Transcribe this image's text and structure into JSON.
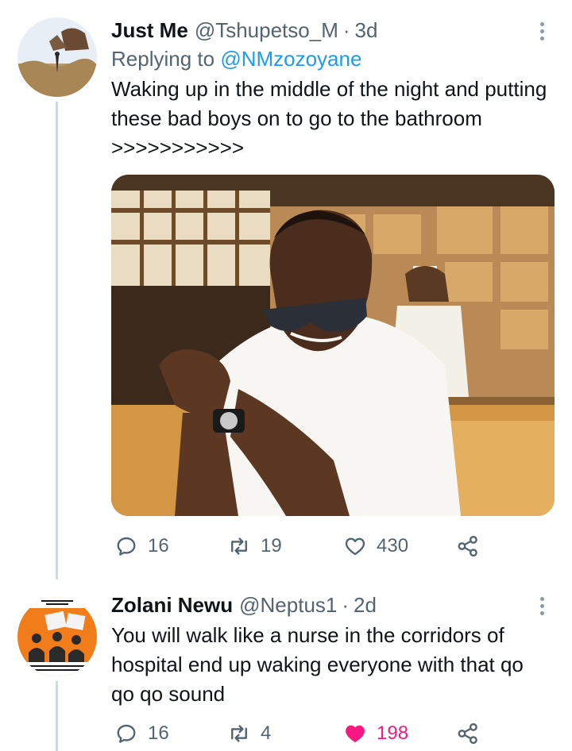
{
  "tweets": [
    {
      "display_name": "Just Me",
      "handle": "@Tshupetso_M",
      "separator": "·",
      "time": "3d",
      "reply_prefix": "Replying to ",
      "reply_to": "@NMzozoyane",
      "text": "Waking up in the middle of the night and putting these bad boys on to go to the bathroom >>>>>>>>>>>",
      "stats": {
        "replies": "16",
        "retweets": "19",
        "likes": "430"
      },
      "liked": false
    },
    {
      "display_name": "Zolani Newu",
      "handle": "@Neptus1",
      "separator": "·",
      "time": "2d",
      "text": "You will walk like a nurse in the corridors of hospital end up waking everyone with that qo qo qo sound",
      "stats": {
        "replies": "16",
        "retweets": "4",
        "likes": "198"
      },
      "liked": true
    }
  ],
  "colors": {
    "text": "#0f1419",
    "secondary": "#536471",
    "link": "#1d9bf0",
    "like_active": "#f91880",
    "thread_line": "#cfd9de"
  },
  "icons": {
    "reply": "reply-bubble-icon",
    "retweet": "retweet-arrows-icon",
    "like": "heart-icon",
    "share": "share-nodes-icon",
    "more": "more-vertical-dots-icon"
  }
}
